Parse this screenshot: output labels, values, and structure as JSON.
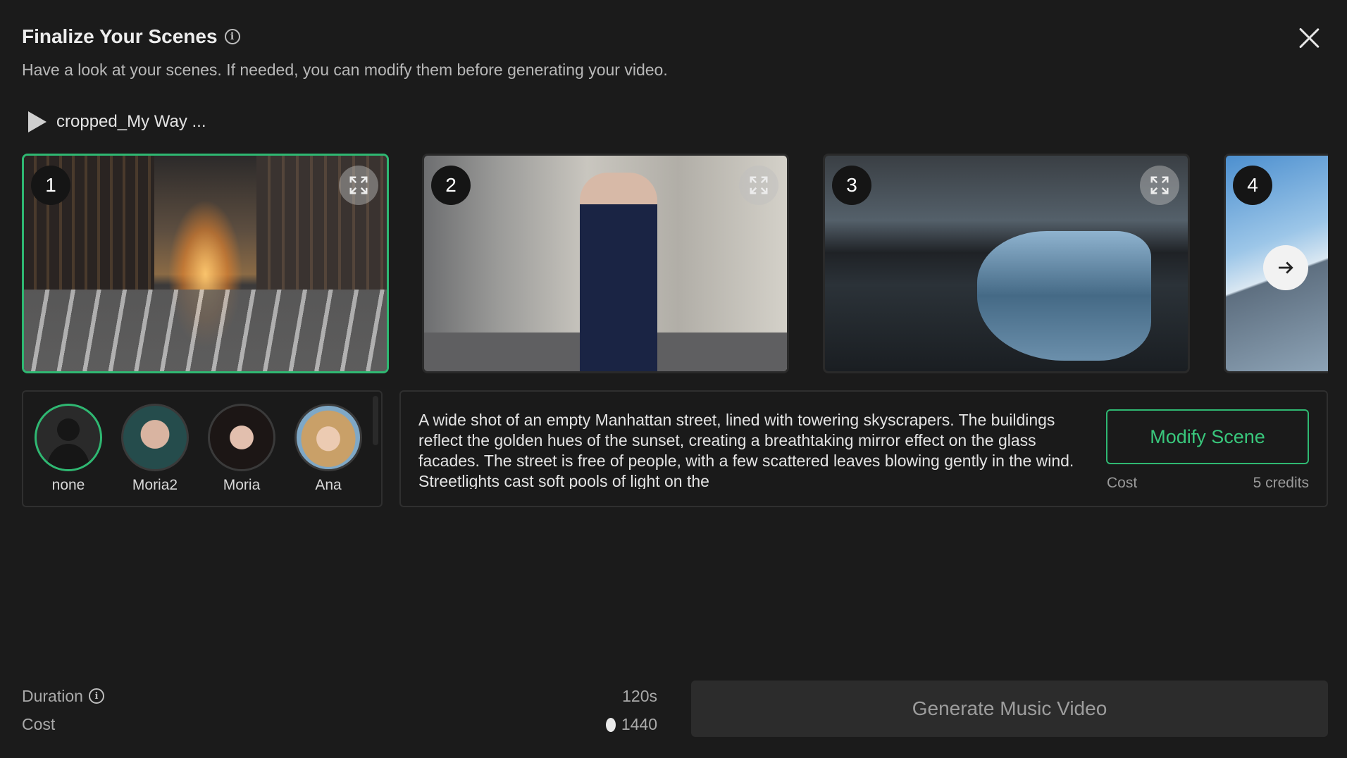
{
  "header": {
    "title": "Finalize Your Scenes",
    "subtitle": "Have a look at your scenes. If needed, you can modify them before generating your video."
  },
  "audio": {
    "name": "cropped_My Way ..."
  },
  "scenes": [
    {
      "number": "1",
      "selected": true
    },
    {
      "number": "2",
      "selected": false
    },
    {
      "number": "3",
      "selected": false
    },
    {
      "number": "4",
      "selected": false
    }
  ],
  "cast": [
    {
      "name": "none",
      "selected": true
    },
    {
      "name": "Moria2",
      "selected": false
    },
    {
      "name": "Moria",
      "selected": false
    },
    {
      "name": "Ana",
      "selected": false
    }
  ],
  "scene_detail": {
    "description": "A wide shot of an empty Manhattan street, lined with towering skyscrapers. The buildings reflect the golden hues of the sunset, creating a breathtaking mirror effect on the glass facades. The street is free of people, with a few scattered leaves blowing gently in the wind. Streetlights cast soft pools of light on the",
    "modify_label": "Modify Scene",
    "cost_label": "Cost",
    "cost_value": "5 credits"
  },
  "footer": {
    "duration_label": "Duration",
    "duration_value": "120s",
    "cost_label": "Cost",
    "cost_value": "1440",
    "generate_label": "Generate Music Video"
  },
  "colors": {
    "accent": "#2fb872",
    "background": "#1b1b1b",
    "panel_border": "#2f2f2f"
  }
}
